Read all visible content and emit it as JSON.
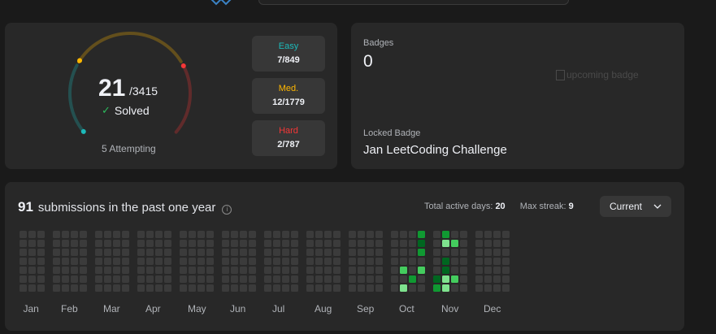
{
  "colors": {
    "card": "#282828",
    "page": "#1a1a1a",
    "easy": "#1cbaba",
    "medium": "#ffb700",
    "hard": "#f63737",
    "cell_empty": "#3b3b3b",
    "cell_level1": "#006620",
    "cell_level2": "#109932",
    "cell_level3": "#44cc5e",
    "cell_level4": "#7ee28e"
  },
  "solved": {
    "count": "21",
    "total": "/3415",
    "label": "Solved",
    "attempting": "5 Attempting",
    "difficulties": [
      {
        "name": "Easy",
        "value": "7/849",
        "solved": 7,
        "total": 849
      },
      {
        "name": "Med.",
        "value": "12/1779",
        "solved": 12,
        "total": 1779
      },
      {
        "name": "Hard",
        "value": "2/787",
        "solved": 2,
        "total": 787
      }
    ]
  },
  "badges": {
    "label": "Badges",
    "count": "0",
    "upcoming_alt": "upcoming badge",
    "locked_label": "Locked Badge",
    "locked_name": "Jan LeetCoding Challenge"
  },
  "submissions": {
    "count": "91",
    "title_text": "submissions in the past one year",
    "active_days_label": "Total active days:",
    "active_days": "20",
    "max_streak_label": "Max streak:",
    "max_streak": "9",
    "period_selected": "Current",
    "months": [
      {
        "name": "Jan",
        "weeks": 3
      },
      {
        "name": "Feb",
        "weeks": 4
      },
      {
        "name": "Mar",
        "weeks": 4
      },
      {
        "name": "Apr",
        "weeks": 4
      },
      {
        "name": "May",
        "weeks": 4
      },
      {
        "name": "Jun",
        "weeks": 4
      },
      {
        "name": "Jul",
        "weeks": 4
      },
      {
        "name": "Aug",
        "weeks": 4
      },
      {
        "name": "Sep",
        "weeks": 4
      },
      {
        "name": "Oct",
        "weeks": 4
      },
      {
        "name": "Nov",
        "weeks": 4
      },
      {
        "name": "Dec",
        "weeks": 4
      }
    ],
    "activity": [
      {
        "month": 9,
        "week": 2,
        "day": 5,
        "level": 2
      },
      {
        "month": 9,
        "week": 3,
        "day": 0,
        "level": 2
      },
      {
        "month": 9,
        "week": 3,
        "day": 1,
        "level": 1
      },
      {
        "month": 9,
        "week": 3,
        "day": 2,
        "level": 2
      },
      {
        "month": 9,
        "week": 1,
        "day": 4,
        "level": 3
      },
      {
        "month": 9,
        "week": 3,
        "day": 4,
        "level": 3
      },
      {
        "month": 9,
        "week": 1,
        "day": 6,
        "level": 4
      },
      {
        "month": 10,
        "week": 0,
        "day": 5,
        "level": 1
      },
      {
        "month": 10,
        "week": 0,
        "day": 6,
        "level": 2
      },
      {
        "month": 10,
        "week": 1,
        "day": 0,
        "level": 2
      },
      {
        "month": 10,
        "week": 1,
        "day": 1,
        "level": 4
      },
      {
        "month": 10,
        "week": 1,
        "day": 3,
        "level": 1
      },
      {
        "month": 10,
        "week": 1,
        "day": 4,
        "level": 1
      },
      {
        "month": 10,
        "week": 1,
        "day": 5,
        "level": 4
      },
      {
        "month": 10,
        "week": 1,
        "day": 6,
        "level": 4
      },
      {
        "month": 10,
        "week": 2,
        "day": 1,
        "level": 3
      },
      {
        "month": 10,
        "week": 2,
        "day": 5,
        "level": 3
      }
    ]
  }
}
